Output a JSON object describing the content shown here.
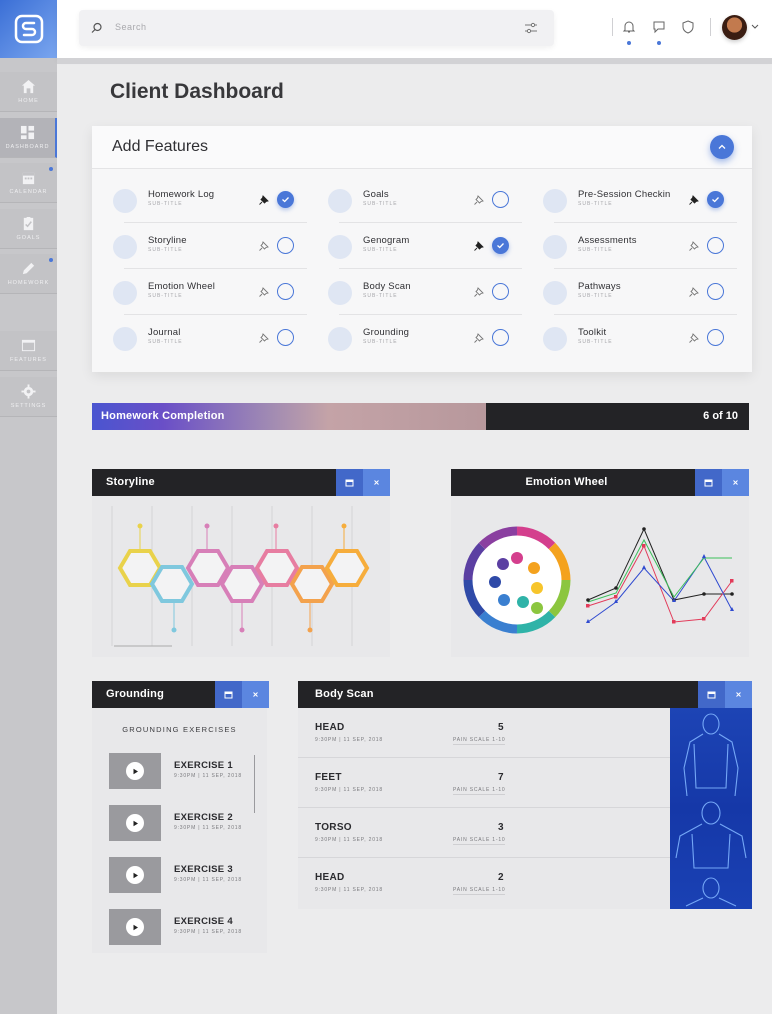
{
  "colors": {
    "accent": "#4a77d8",
    "dark": "#232326",
    "sidebar": "#c7c7ca"
  },
  "sidebar": {
    "logo_icon": "logo-s-icon",
    "items": [
      {
        "label": "HOME",
        "icon": "home-icon"
      },
      {
        "label": "DASHBOARD",
        "icon": "grid-icon"
      },
      {
        "label": "CALENDAR",
        "icon": "calendar-icon"
      },
      {
        "label": "GOALS",
        "icon": "clipboard-icon"
      },
      {
        "label": "HOMEWORK",
        "icon": "pencil-icon"
      },
      {
        "label": "FEATURES",
        "icon": "window-icon"
      },
      {
        "label": "SETTINGS",
        "icon": "gear-icon"
      }
    ]
  },
  "topbar": {
    "search_placeholder": "Search",
    "icons": [
      "bell-icon",
      "message-icon",
      "shield-icon"
    ]
  },
  "page": {
    "title": "Client Dashboard"
  },
  "features": {
    "title": "Add Features",
    "items": [
      {
        "name": "Homework Log",
        "sub": "SUB-TITLE",
        "checked": true
      },
      {
        "name": "Storyline",
        "sub": "SUB-TITLE",
        "checked": false
      },
      {
        "name": "Emotion Wheel",
        "sub": "SUB-TITLE",
        "checked": false
      },
      {
        "name": "Journal",
        "sub": "SUB-TITLE",
        "checked": false
      },
      {
        "name": "Goals",
        "sub": "SUB-TITLE",
        "checked": false
      },
      {
        "name": "Genogram",
        "sub": "SUB-TITLE",
        "checked": true
      },
      {
        "name": "Body Scan",
        "sub": "SUB-TITLE",
        "checked": false
      },
      {
        "name": "Grounding",
        "sub": "SUB-TITLE",
        "checked": false
      },
      {
        "name": "Pre-Session Checkin",
        "sub": "SUB-TITLE",
        "checked": true
      },
      {
        "name": "Assessments",
        "sub": "SUB-TITLE",
        "checked": false
      },
      {
        "name": "Pathways",
        "sub": "SUB-TITLE",
        "checked": false
      },
      {
        "name": "Toolkit",
        "sub": "SUB-TITLE",
        "checked": false
      }
    ]
  },
  "homework": {
    "label": "Homework Completion",
    "count": "6 of 10",
    "progress": 0.6
  },
  "storyline": {
    "title": "Storyline"
  },
  "emotion_wheel": {
    "title": "Emotion Wheel"
  },
  "grounding": {
    "title": "Grounding",
    "heading": "GROUNDING EXERCISES",
    "exercises": [
      {
        "name": "EXERCISE 1",
        "date": "9:30PM | 11 SEP, 2018"
      },
      {
        "name": "EXERCISE 2",
        "date": "9:30PM | 11 SEP, 2018"
      },
      {
        "name": "EXERCISE 3",
        "date": "9:30PM | 11 SEP, 2018"
      },
      {
        "name": "EXERCISE 4",
        "date": "9:30PM | 11 SEP, 2018"
      }
    ]
  },
  "body_scan": {
    "title": "Body Scan",
    "rows": [
      {
        "part": "HEAD",
        "score": "5",
        "date": "9:30PM | 11 SEP, 2018",
        "scale": "PAIN SCALE 1-10"
      },
      {
        "part": "FEET",
        "score": "7",
        "date": "9:30PM | 11 SEP, 2018",
        "scale": "PAIN SCALE 1-10"
      },
      {
        "part": "TORSO",
        "score": "3",
        "date": "9:30PM | 11 SEP, 2018",
        "scale": "PAIN SCALE 1-10"
      },
      {
        "part": "HEAD",
        "score": "2",
        "date": "9:30PM | 11 SEP, 2018",
        "scale": "PAIN SCALE 1-10"
      }
    ]
  }
}
